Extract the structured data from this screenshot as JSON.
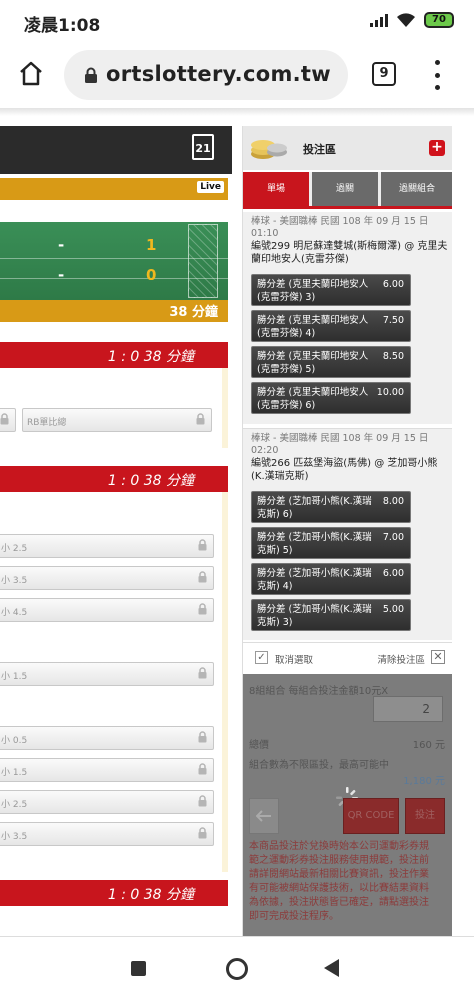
{
  "status": {
    "time": "凌晨1:08",
    "battery": "70"
  },
  "browser": {
    "url": "ortslottery.com.tw",
    "tab_count": "9"
  },
  "left": {
    "calendar_day": "21",
    "live_label": "Live",
    "scores": [
      {
        "dash": "-",
        "value": "1"
      },
      {
        "dash": "-",
        "value": "0"
      }
    ],
    "minute_label": "38 分鐘",
    "sections": [
      {
        "score_time": "1 : 0  38 分鐘"
      },
      {
        "score_time": "1 : 0  38 分鐘"
      },
      {
        "score_time": "1 : 0  38 分鐘"
      }
    ],
    "first_row_options": [
      "",
      "RB單比總"
    ],
    "options": [
      "小 2.5",
      "小 3.5",
      "小 4.5",
      "小 1.5",
      "小 0.5",
      "小 1.5",
      "小 2.5",
      "小 3.5"
    ]
  },
  "betslip": {
    "title": "投注區",
    "tabs": [
      "單場",
      "過關",
      "過關組合"
    ],
    "groups": [
      {
        "meta": "棒球 - 美國職棒 民國 108 年 09 月 15 日",
        "time": "01:10",
        "match": "編號299 明尼蘇達雙城(斯梅爾澤) @ 克里夫蘭印地安人(克雷芬傑)",
        "odds": [
          {
            "label": "勝分差 (克里夫蘭印地安人(克雷芬傑) 3)",
            "value": "6.00"
          },
          {
            "label": "勝分差 (克里夫蘭印地安人(克雷芬傑) 4)",
            "value": "7.50"
          },
          {
            "label": "勝分差 (克里夫蘭印地安人(克雷芬傑) 5)",
            "value": "8.50"
          },
          {
            "label": "勝分差 (克里夫蘭印地安人(克雷芬傑) 6)",
            "value": "10.00"
          }
        ]
      },
      {
        "meta": "棒球 - 美國職棒 民國 108 年 09 月 15 日",
        "time": "02:20",
        "match": "編號266 匹茲堡海盜(馬佛) @ 芝加哥小熊(K.漢瑞克斯)",
        "odds": [
          {
            "label": "勝分差 (芝加哥小熊(K.漢瑞克斯) 6)",
            "value": "8.00"
          },
          {
            "label": "勝分差 (芝加哥小熊(K.漢瑞克斯) 5)",
            "value": "7.00"
          },
          {
            "label": "勝分差 (芝加哥小熊(K.漢瑞克斯) 4)",
            "value": "6.00"
          },
          {
            "label": "勝分差 (芝加哥小熊(K.漢瑞克斯) 3)",
            "value": "5.00"
          }
        ]
      }
    ],
    "cancel_label": "取消選取",
    "clear_label": "清除投注區",
    "combo_label": "8組組合   每組合投注金額10元X",
    "multiplier": "2",
    "total_label": "總價",
    "total_value": "160 元",
    "max_label": "組合數為不限區投，最高可能中",
    "max_value": "1,180 元",
    "qr_label": "QR CODE",
    "submit_label": "投注",
    "note": "本商品投注於兌換時始本公司運動彩券規範之運動彩券投注服務使用規範，投注前請詳閱網站最新相關比賽資訊，投注作業有可能被網站保護技術，以比賽結果資料為依據，投注狀態皆已確定，請點選投注即可完成投注程序。"
  }
}
